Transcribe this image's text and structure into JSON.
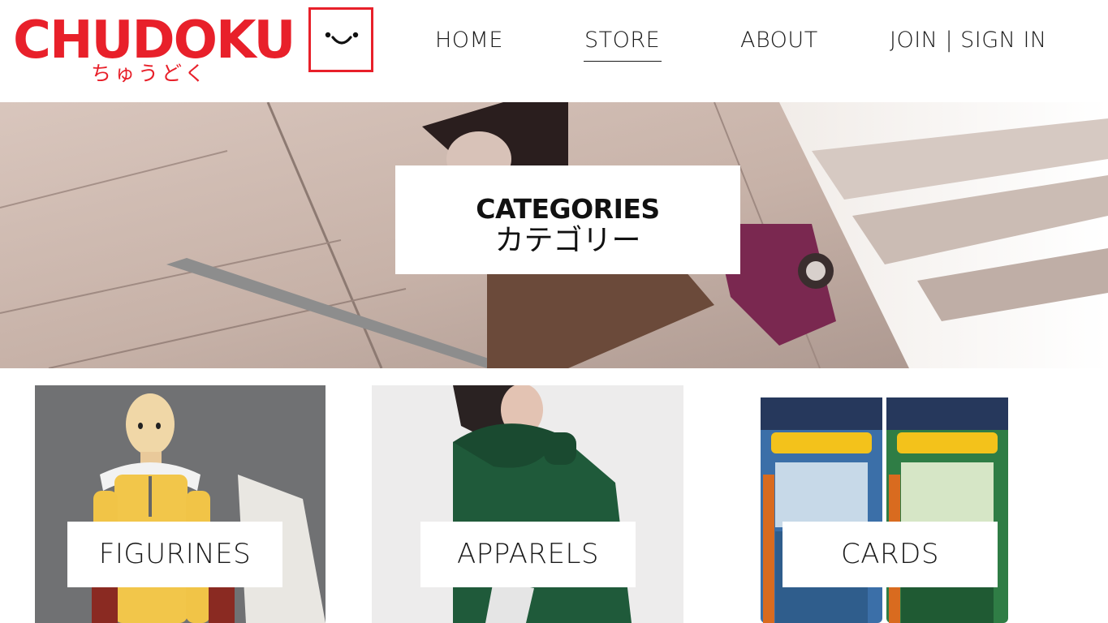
{
  "header": {
    "logo": {
      "title": "CHUDOKU",
      "subtitle": "ちゅうどく",
      "face_icon": "smiley-face-icon"
    },
    "nav": {
      "home": "HOME",
      "store": "STORE",
      "about": "ABOUT",
      "join": "JOIN | SIGN IN",
      "active": "STORE"
    }
  },
  "hero": {
    "title": "CATEGORIES",
    "subtitle": "カテゴリー"
  },
  "categories": [
    {
      "label": "FIGURINES"
    },
    {
      "label": "APPARELS"
    },
    {
      "label": "CARDS"
    }
  ],
  "colors": {
    "brand": "#e8202a",
    "text": "#1a1a1a",
    "background": "#ffffff"
  }
}
